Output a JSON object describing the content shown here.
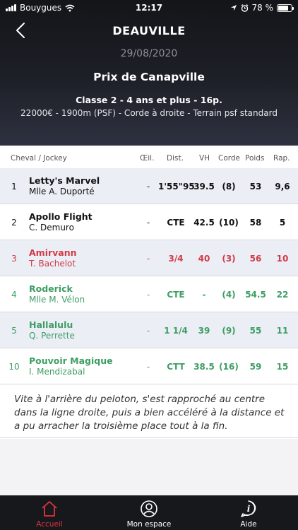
{
  "status_bar": {
    "carrier": "Bouygues",
    "time": "12:17",
    "battery": "78 %",
    "battery_level": 0.78
  },
  "header": {
    "venue": "DEAUVILLE",
    "date": "29/08/2020",
    "race_name": "Prix de Canapville",
    "race_class": "Classe 2 - 4 ans et plus - 16p.",
    "race_details": "22000€ - 1900m (PSF) - Corde à droite - Terrain psf standard"
  },
  "columns": {
    "horse_jockey": "Cheval / Jockey",
    "oeil": "Œil.",
    "dist": "Dist.",
    "vh": "VH",
    "corde": "Corde",
    "poids": "Poids",
    "rap": "Rap."
  },
  "results": [
    {
      "rank": "1",
      "horse": "Letty's Marvel",
      "jockey": "Mlle A. Duporté",
      "oeil": "-",
      "dist": "1'55\"95",
      "vh": "39.5",
      "corde": "(8)",
      "poids": "53",
      "rap": "9,6",
      "color": "black"
    },
    {
      "rank": "2",
      "horse": "Apollo Flight",
      "jockey": "C. Demuro",
      "oeil": "-",
      "dist": "CTE",
      "vh": "42.5",
      "corde": "(10)",
      "poids": "58",
      "rap": "5",
      "color": "black"
    },
    {
      "rank": "3",
      "horse": "Amirvann",
      "jockey": "T. Bachelot",
      "oeil": "-",
      "dist": "3/4",
      "vh": "40",
      "corde": "(3)",
      "poids": "56",
      "rap": "10",
      "color": "red"
    },
    {
      "rank": "4",
      "horse": "Roderick",
      "jockey": "Mlle M. Vélon",
      "oeil": "-",
      "dist": "CTE",
      "vh": "-",
      "corde": "(4)",
      "poids": "54.5",
      "rap": "22",
      "color": "green"
    },
    {
      "rank": "5",
      "horse": "Hallalulu",
      "jockey": "Q. Perrette",
      "oeil": "-",
      "dist": "1 1/4",
      "vh": "39",
      "corde": "(9)",
      "poids": "55",
      "rap": "11",
      "color": "green"
    },
    {
      "rank": "10",
      "horse": "Pouvoir Magique",
      "jockey": "I. Mendizabal",
      "oeil": "-",
      "dist": "CTT",
      "vh": "38.5",
      "corde": "(16)",
      "poids": "59",
      "rap": "15",
      "color": "green"
    }
  ],
  "comment": "Vite à l'arrière du peloton, s'est rapproché au centre dans la ligne droite, puis a bien accéléré à la distance et a pu arracher la troisième place tout à la fin.",
  "tabs": [
    {
      "label": "Accueil",
      "icon": "home-icon",
      "active": true
    },
    {
      "label": "Mon espace",
      "icon": "user-icon",
      "active": false
    },
    {
      "label": "Aide",
      "icon": "help-icon",
      "active": false
    }
  ],
  "colors": {
    "accent_red": "#d23a45",
    "green": "#3d9e63",
    "shaded_row": "#eceef6",
    "tab_active": "#e0333f",
    "tab_inactive": "#ffffff"
  }
}
